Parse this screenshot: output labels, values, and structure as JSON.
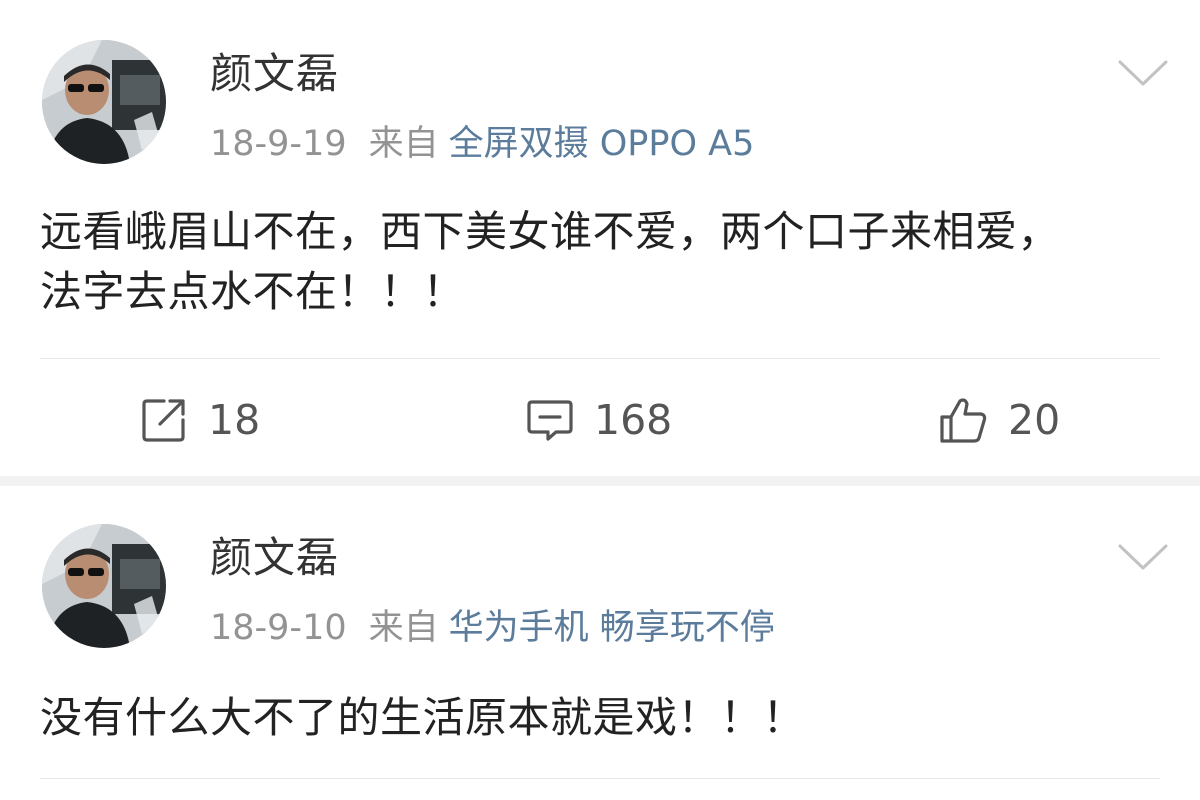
{
  "posts": [
    {
      "author": "颜文磊",
      "date": "18-9-19",
      "from_label": "来自",
      "device": "全屏双摄 OPPO A5",
      "content_line1": "远看峨眉山不在，西下美女谁不爱，两个口子来相爱，",
      "content_line2": "法字去点水不在！！！",
      "actions": {
        "repost": {
          "icon": "share-icon",
          "count": "18"
        },
        "comment": {
          "icon": "comment-icon",
          "count": "168"
        },
        "like": {
          "icon": "thumbs-up-icon",
          "count": "20"
        }
      }
    },
    {
      "author": "颜文磊",
      "date": "18-9-10",
      "from_label": "来自",
      "device": "华为手机 畅享玩不停",
      "content_line1": "没有什么大不了的生活原本就是戏！！！"
    }
  ],
  "colors": {
    "text": "#222222",
    "meta_gray": "#939393",
    "device_link": "#5c7c9c",
    "divider": "#e6e6e6",
    "band": "#f2f2f2"
  }
}
